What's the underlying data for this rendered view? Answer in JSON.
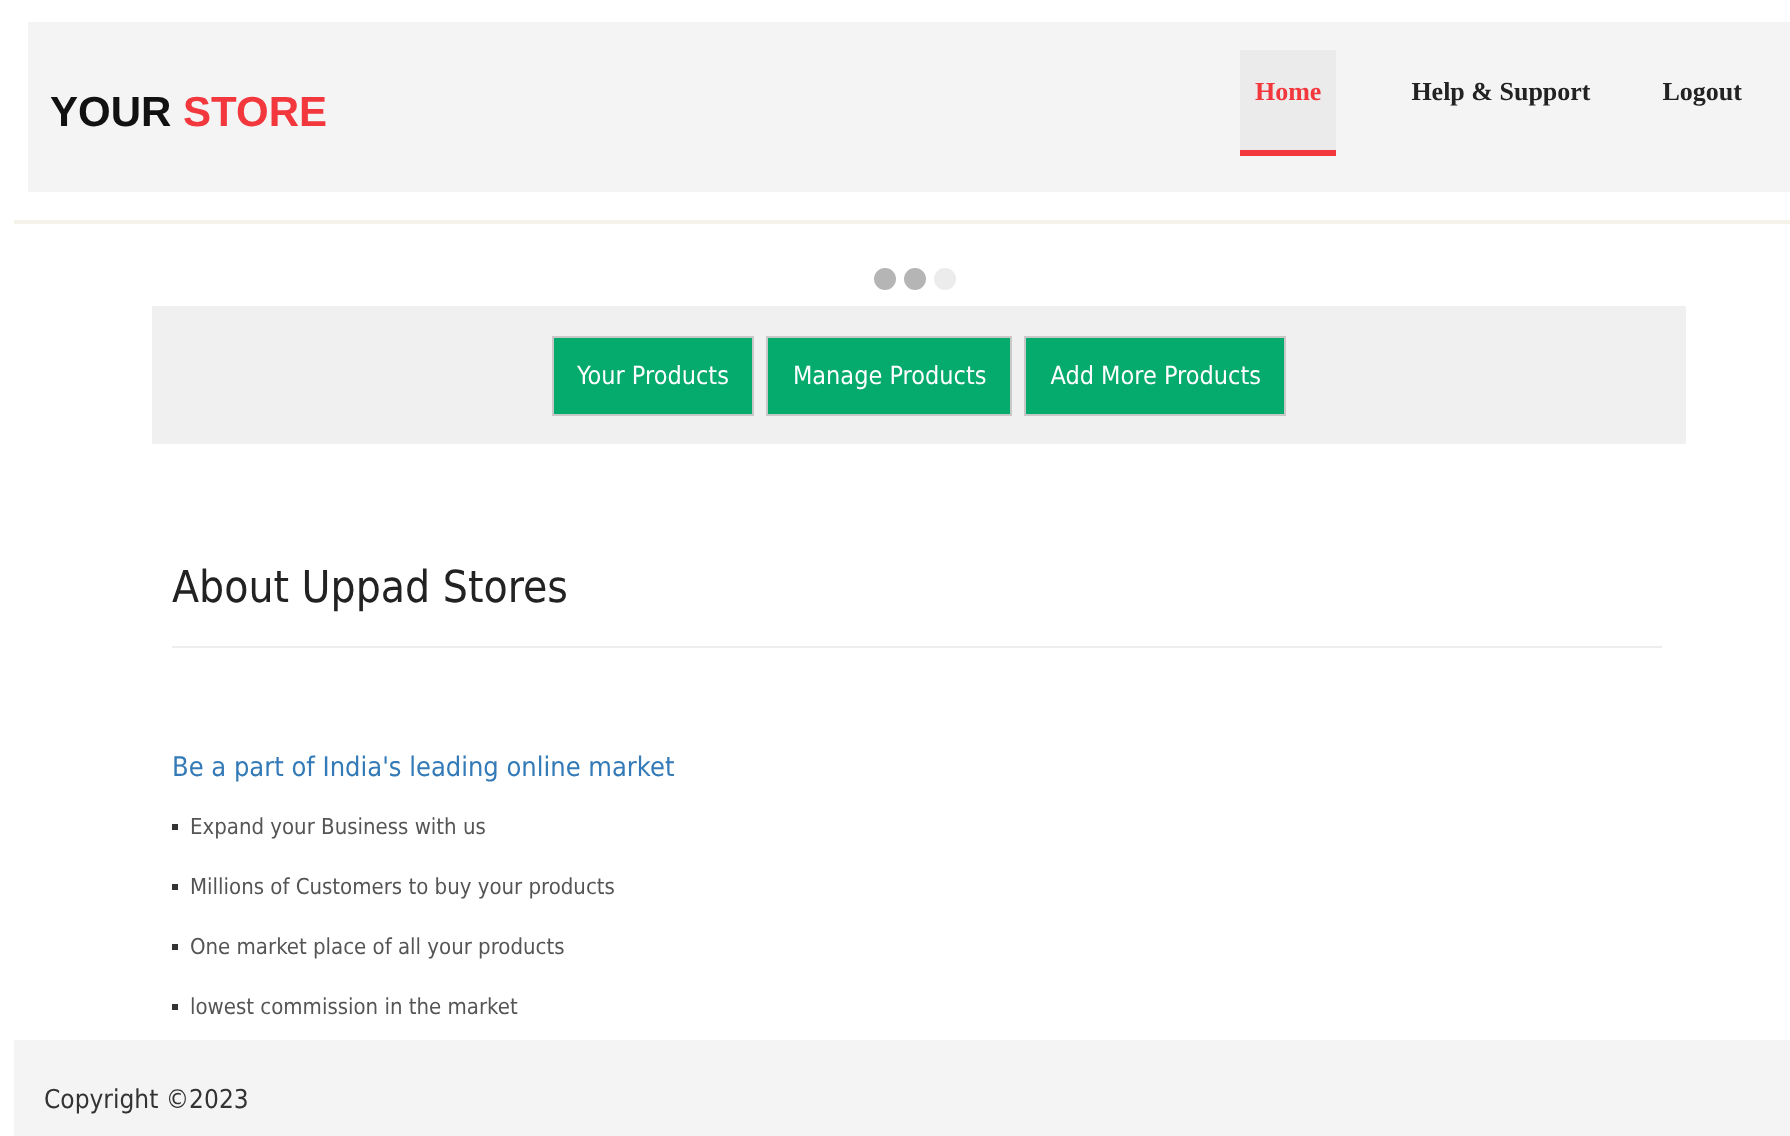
{
  "logo": {
    "first": "YOUR",
    "second": "STORE"
  },
  "nav": [
    {
      "label": "Home",
      "selected": true
    },
    {
      "label": "Help & Support",
      "selected": false
    },
    {
      "label": "Logout",
      "selected": false
    }
  ],
  "carousel_dots": [
    {
      "selected": false
    },
    {
      "selected": false
    },
    {
      "selected": true
    }
  ],
  "buttons": [
    "Your Products",
    "Manage Products",
    "Add More Products"
  ],
  "about": {
    "heading": "About Uppad Stores",
    "tagline": "Be a part of India's leading online market",
    "points": [
      "Expand your Business with us",
      "Millions of Customers to buy your products",
      "One market place of all your products",
      "lowest commission in the market"
    ]
  },
  "footer": {
    "copyright": "Copyright ©2023"
  }
}
